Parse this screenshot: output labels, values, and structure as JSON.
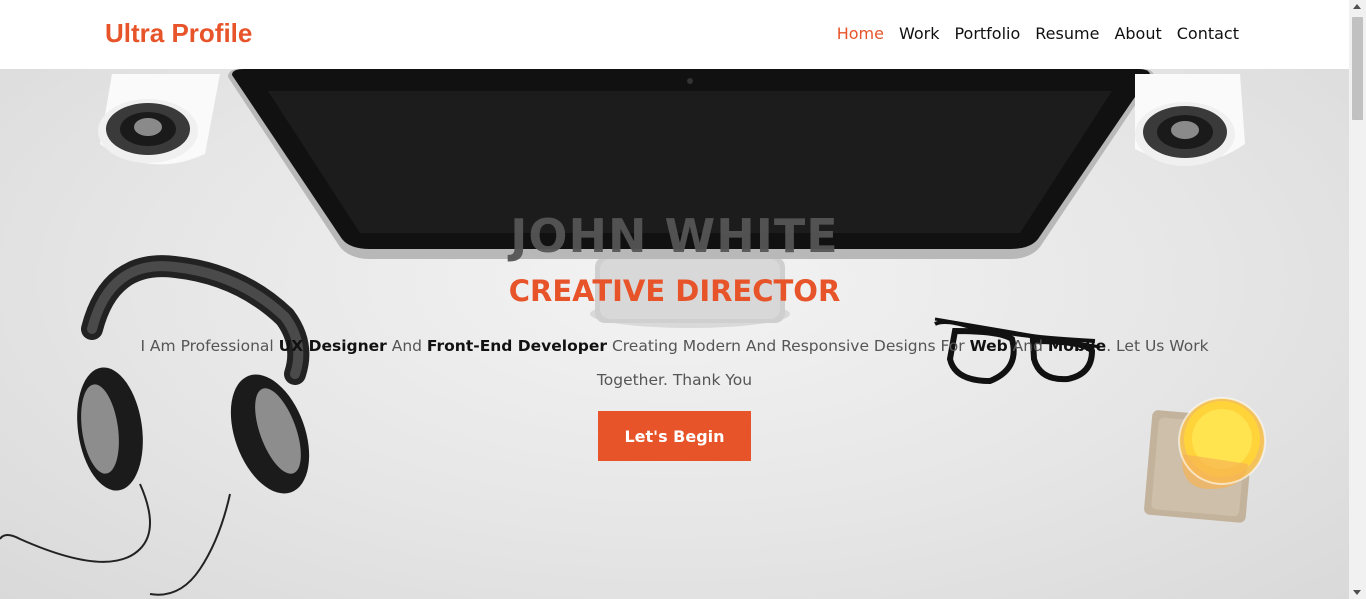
{
  "brand": "Ultra Profile",
  "nav": [
    "Home",
    "Work",
    "Portfolio",
    "Resume",
    "About",
    "Contact"
  ],
  "nav_active": "Home",
  "hero": {
    "name": "JOHN WHITE",
    "role": "CREATIVE DIRECTOR",
    "desc_parts": [
      "I Am Professional ",
      "UX Designer",
      " And ",
      "Front-End Developer",
      " Creating Modern And Responsive Designs For ",
      "Web",
      " And ",
      "Mobile",
      ". Let Us Work Together. Thank You"
    ],
    "cta": "Let's Begin"
  },
  "colors": {
    "accent": "#e8542a",
    "text": "#111111",
    "muted": "#555555"
  },
  "icons": [
    "monitor-icon",
    "speaker-icon",
    "headphones-icon",
    "glasses-icon",
    "juice-glass-icon",
    "coaster-icon"
  ]
}
